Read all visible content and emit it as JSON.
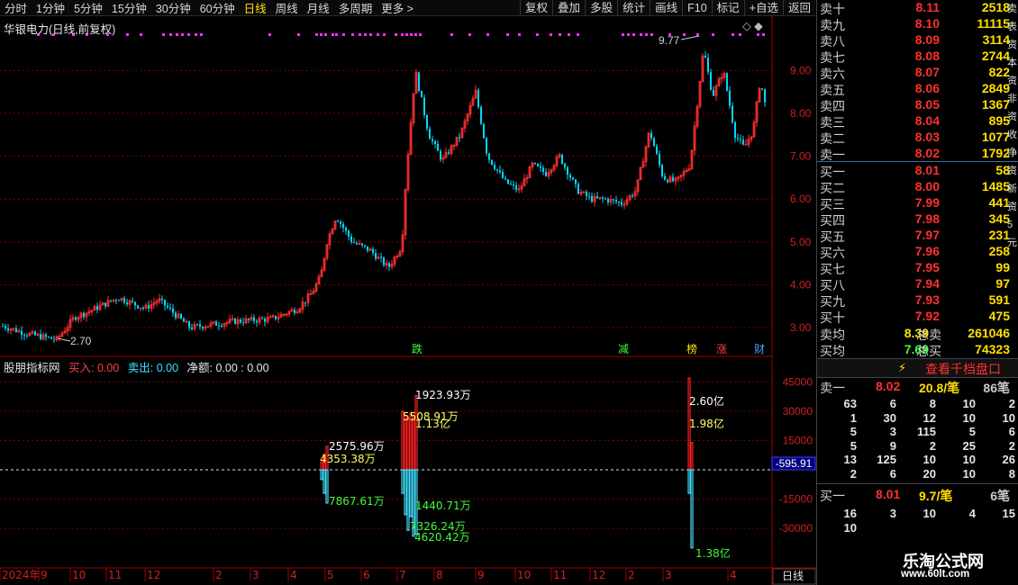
{
  "toolbar": {
    "periods": [
      "分时",
      "1分钟",
      "5分钟",
      "15分钟",
      "30分钟",
      "60分钟",
      "日线",
      "周线",
      "月线",
      "多周期",
      "更多 >"
    ],
    "active_period": "日线",
    "right_buttons": [
      "复权",
      "叠加",
      "多股",
      "统计",
      "画线",
      "F10",
      "标记",
      "+自选",
      "返回"
    ]
  },
  "main_chart": {
    "title": "华银电力(日线,前复权)",
    "diamond_icons": "◇ ◆",
    "high_label": "9.77",
    "low_label": "2.70",
    "y_ticks": [
      "9.00",
      "8.00",
      "7.00",
      "6.00",
      "5.00",
      "4.00",
      "3.00"
    ],
    "event_tags": [
      {
        "text": "跌",
        "color": "#3cff3c"
      },
      {
        "text": "减",
        "color": "#3cff3c"
      },
      {
        "text": "榜",
        "color": "#ffe000"
      },
      {
        "text": "涨",
        "color": "#ff4040"
      },
      {
        "text": "财",
        "color": "#40a0ff"
      }
    ]
  },
  "indicator": {
    "name": "股朋指标网",
    "buy_label": "买入: 0.00",
    "sell_label": "卖出: 0.00",
    "net_label": "净额: 0.00 : 0.00",
    "current_value": "-595.91",
    "y_ticks": [
      "45000",
      "30000",
      "15000",
      "0",
      "-15000",
      "-30000"
    ],
    "annotations": [
      {
        "text": "2575.96万",
        "color": "#ffffff"
      },
      {
        "text": "4353.38万",
        "color": "#ffff60"
      },
      {
        "text": "7867.61万",
        "color": "#3cff3c"
      },
      {
        "text": "1923.93万",
        "color": "#ffffff"
      },
      {
        "text": "5508.91万",
        "color": "#ffff60"
      },
      {
        "text": "1.13亿",
        "color": "#ffff60"
      },
      {
        "text": "1440.71万",
        "color": "#3cff3c"
      },
      {
        "text": "7326.24万",
        "color": "#3cff3c"
      },
      {
        "text": "4620.42万",
        "color": "#3cff3c"
      },
      {
        "text": "2.60亿",
        "color": "#ffffff"
      },
      {
        "text": "1.98亿",
        "color": "#ffff60"
      },
      {
        "text": "1.38亿",
        "color": "#3cff3c"
      }
    ]
  },
  "x_axis": {
    "labels": [
      "2024年",
      "9",
      "10",
      "11",
      "12",
      "2",
      "3",
      "4",
      "5",
      "6",
      "7",
      "8",
      "9",
      "10",
      "11",
      "12",
      "2",
      "3",
      "4"
    ],
    "period_label": "日线"
  },
  "order_book": {
    "sell": [
      {
        "label": "卖十",
        "price": "8.11",
        "vol": "2518",
        "mark": "*"
      },
      {
        "label": "卖九",
        "price": "8.10",
        "vol": "11115",
        "mark": ""
      },
      {
        "label": "卖八",
        "price": "8.09",
        "vol": "3114",
        "mark": ""
      },
      {
        "label": "卖七",
        "price": "8.08",
        "vol": "2744",
        "mark": ""
      },
      {
        "label": "卖六",
        "price": "8.07",
        "vol": "822",
        "mark": ""
      },
      {
        "label": "卖五",
        "price": "8.06",
        "vol": "2849",
        "mark": ""
      },
      {
        "label": "卖四",
        "price": "8.05",
        "vol": "1367",
        "mark": ""
      },
      {
        "label": "卖三",
        "price": "8.04",
        "vol": "895",
        "mark": ""
      },
      {
        "label": "卖二",
        "price": "8.03",
        "vol": "1077",
        "mark": ""
      },
      {
        "label": "卖一",
        "price": "8.02",
        "vol": "1792",
        "mark": ""
      }
    ],
    "buy": [
      {
        "label": "买一",
        "price": "8.01",
        "vol": "58",
        "mark": ""
      },
      {
        "label": "买二",
        "price": "8.00",
        "vol": "1485",
        "mark": ""
      },
      {
        "label": "买三",
        "price": "7.99",
        "vol": "441",
        "mark": ""
      },
      {
        "label": "买四",
        "price": "7.98",
        "vol": "345",
        "mark": ""
      },
      {
        "label": "买五",
        "price": "7.97",
        "vol": "231",
        "mark": ""
      },
      {
        "label": "买六",
        "price": "7.96",
        "vol": "258",
        "mark": ""
      },
      {
        "label": "买七",
        "price": "7.95",
        "vol": "99",
        "mark": ""
      },
      {
        "label": "买八",
        "price": "7.94",
        "vol": "97",
        "mark": ""
      },
      {
        "label": "买九",
        "price": "7.93",
        "vol": "591",
        "mark": ""
      },
      {
        "label": "买十",
        "price": "7.92",
        "vol": "475",
        "mark": "*"
      }
    ],
    "avg_sell": {
      "label": "卖均",
      "price": "8.39",
      "total_label": "总卖",
      "total": "261046"
    },
    "avg_buy": {
      "label": "买均",
      "price": "7.69",
      "total_label": "总买",
      "total": "74323"
    },
    "depth_button": "查看千档盘口",
    "sell1_queue": {
      "label": "卖一",
      "price": "8.02",
      "avg": "20.8/笔",
      "count": "86笔",
      "rows": [
        [
          "63",
          "6",
          "8",
          "10",
          "2"
        ],
        [
          "1",
          "30",
          "12",
          "10",
          "10"
        ],
        [
          "5",
          "3",
          "115",
          "5",
          "6"
        ],
        [
          "5",
          "9",
          "2",
          "25",
          "2"
        ],
        [
          "13",
          "125",
          "10",
          "10",
          "26"
        ],
        [
          "2",
          "6",
          "20",
          "10",
          "8"
        ]
      ]
    },
    "buy1_queue": {
      "label": "买一",
      "price": "8.01",
      "avg": "9.7/笔",
      "count": "6笔",
      "rows": [
        [
          "16",
          "3",
          "10",
          "4",
          "15"
        ],
        [
          "10",
          "",
          "",
          "",
          ""
        ]
      ]
    }
  },
  "right_edge_chars": [
    "卖",
    "表",
    "资",
    "本",
    "资",
    "非",
    "资",
    "收",
    "净",
    "资",
    "新",
    "资",
    "5",
    "元"
  ],
  "watermark": {
    "line1": "乐淘公式网",
    "line2": "www.60lt.com"
  }
}
